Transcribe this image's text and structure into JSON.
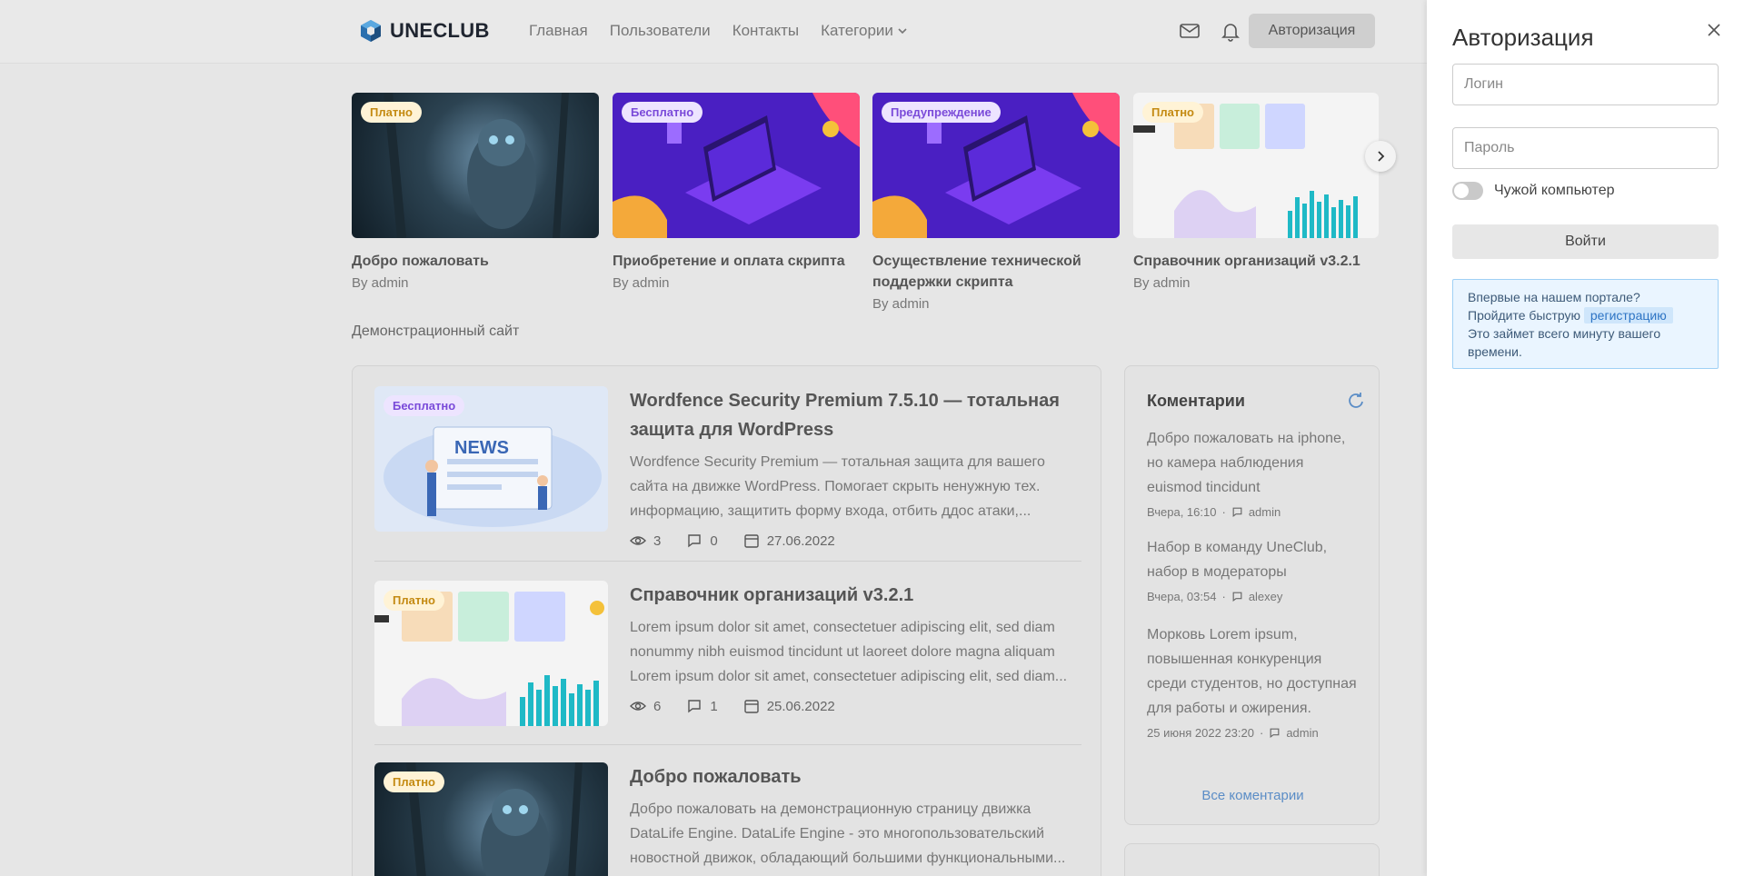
{
  "header": {
    "logo": "UNECLUB",
    "nav": [
      "Главная",
      "Пользователи",
      "Контакты",
      "Категории"
    ],
    "auth_button": "Авторизация"
  },
  "featured": [
    {
      "badge": "Платно",
      "title": "Добро пожаловать",
      "by": "By admin"
    },
    {
      "badge": "Бесплатно",
      "title": "Приобретение и оплата скрипта",
      "by": "By admin"
    },
    {
      "badge": "Предупреждение",
      "title": "Осуществление технической поддержки скрипта",
      "by": "By admin"
    },
    {
      "badge": "Платно",
      "title": "Справочник организаций v3.2.1",
      "by": "By admin"
    }
  ],
  "site_label": "Демонстрационный сайт",
  "posts": [
    {
      "badge": "Бесплатно",
      "image_text": "NEWS",
      "title": "Wordfence Security Premium 7.5.10 — тотальная защита для WordPress",
      "text": "Wordfence Security Premium — тотальная защита для вашего сайта на движке WordPress. Помогает скрыть ненужную тех. информацию, защитить форму входа, отбить ддос атаки,...",
      "views": "3",
      "comments": "0",
      "date": "27.06.2022"
    },
    {
      "badge": "Платно",
      "title": "Справочник организаций v3.2.1",
      "text": "Lorem ipsum dolor sit amet, consectetuer adipiscing elit, sed diam nonummy nibh euismod tincidunt ut laoreet dolore magna aliquam Lorem ipsum dolor sit amet, consectetuer adipiscing elit, sed diam...",
      "views": "6",
      "comments": "1",
      "date": "25.06.2022"
    },
    {
      "badge": "Платно",
      "title": "Добро пожаловать",
      "text": "Добро пожаловать на демонстрационную страницу движка DataLife Engine. DataLife Engine - это многопользовательский новостной движок, обладающий большими функциональными..."
    }
  ],
  "comments_widget": {
    "title": "Коментарии",
    "items": [
      {
        "text": "Добро пожаловать на iphone, но камера наблюдения euismod tincidunt",
        "time": "Вчера, 16:10",
        "author": "admin"
      },
      {
        "text": "Набор в команду UneClub, набор в модераторы",
        "time": "Вчера, 03:54",
        "author": "alexey"
      },
      {
        "text": "Морковь Lorem ipsum, повышенная конкуренция среди студентов, но доступная для работы и ожирения.",
        "time": "25 июня 2022 23:20",
        "author": "admin"
      }
    ],
    "all_link": "Все коментарии"
  },
  "drawer": {
    "title": "Авторизация",
    "login_placeholder": "Логин",
    "password_placeholder": "Пароль",
    "toggle_label": "Чужой компьютер",
    "login_button": "Войти",
    "info_line1": "Впервые на нашем портале?",
    "info_line2_prefix": "Пройдите быструю",
    "info_link": "регистрацию",
    "info_line3": "Это займет всего минуту вашего времени."
  },
  "colors": {
    "accent_link": "#5b8dc6",
    "badge_paid": "#c48a12",
    "badge_free": "#7a4ad9"
  }
}
